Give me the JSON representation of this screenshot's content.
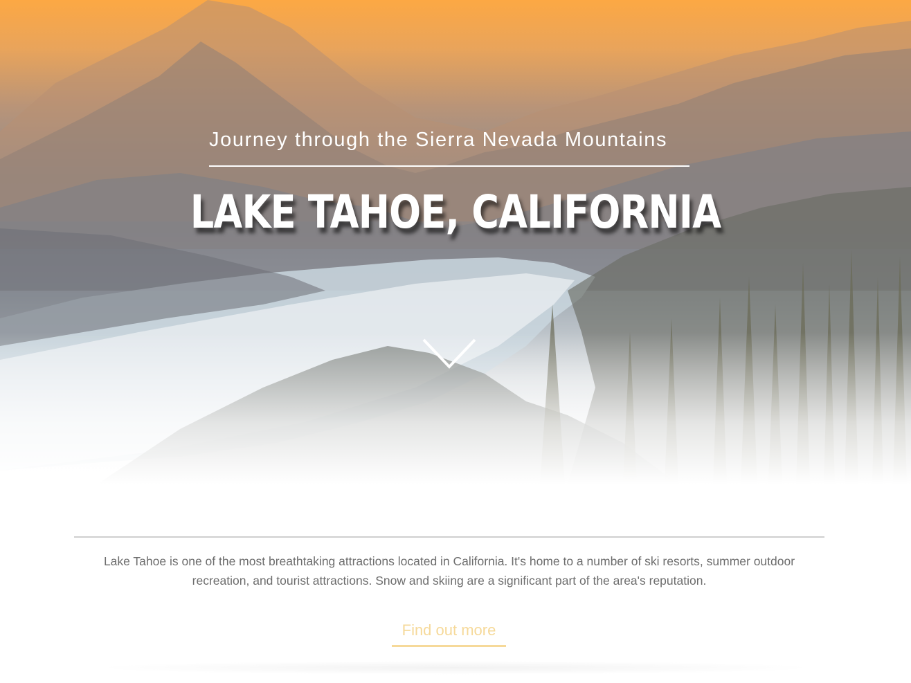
{
  "hero": {
    "subtitle": "Journey through the Sierra Nevada Mountains",
    "title": "LAKE TAHOE, CALIFORNIA",
    "scroll_icon": "chevron-down-icon"
  },
  "intro": {
    "description": "Lake Tahoe is one of the most breathtaking attractions located in California. It's home to a number of ski resorts, summer outdoor recreation, and tourist attractions. Snow and skiing are a significant part of the area's reputation.",
    "cta_label": "Find out more"
  },
  "colors": {
    "accent": "#f6d999",
    "sky_top": "#fca844",
    "text_muted": "#6d6d6d"
  }
}
